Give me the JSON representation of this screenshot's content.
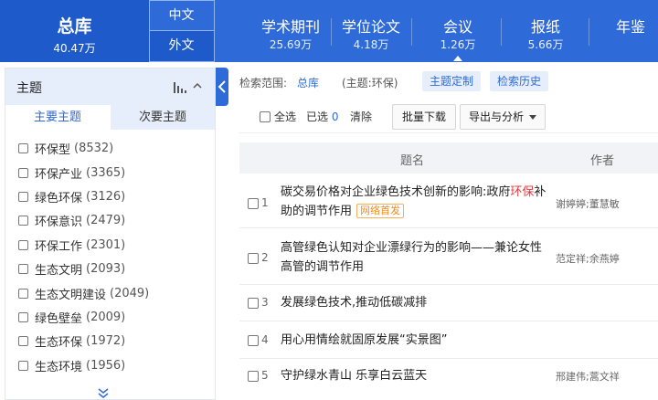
{
  "header": {
    "total": {
      "label": "总库",
      "count": "40.47万"
    },
    "lang_tabs": [
      "中文",
      "外文"
    ],
    "db_tabs": [
      {
        "label": "学术期刊",
        "count": "25.69万"
      },
      {
        "label": "学位论文",
        "count": "4.18万"
      },
      {
        "label": "会议",
        "count": "1.26万"
      },
      {
        "label": "报纸",
        "count": "5.66万"
      },
      {
        "label": "年鉴",
        "count": ""
      }
    ]
  },
  "sidebar": {
    "title": "主题",
    "tabs": [
      "主要主题",
      "次要主题"
    ],
    "facets": [
      {
        "label": "环保型",
        "count": "(8532)"
      },
      {
        "label": "环保产业",
        "count": "(3365)"
      },
      {
        "label": "绿色环保",
        "count": "(3126)"
      },
      {
        "label": "环保意识",
        "count": "(2479)"
      },
      {
        "label": "环保工作",
        "count": "(2301)"
      },
      {
        "label": "生态文明",
        "count": "(2093)"
      },
      {
        "label": "生态文明建设",
        "count": "(2049)"
      },
      {
        "label": "绿色壁垒",
        "count": "(2009)"
      },
      {
        "label": "生态环保",
        "count": "(1972)"
      },
      {
        "label": "生态环境",
        "count": "(1956)"
      }
    ]
  },
  "search": {
    "scope_label": "检索范围:",
    "scope_value": "总库",
    "query": "(主题:环保)",
    "topic_button": "主题定制",
    "history_button": "检索历史"
  },
  "toolbar": {
    "select_all": "全选",
    "selected_label": "已选",
    "selected_count": "0",
    "clear": "清除",
    "batch_download": "批量下载",
    "export": "导出与分析"
  },
  "table": {
    "headers": {
      "title": "题名",
      "author": "作者"
    },
    "rows": [
      {
        "index": "1",
        "title_before": "碳交易价格对企业绿色技术创新的影响:政府",
        "title_highlight": "环保",
        "title_after": "补助的调节作用",
        "badge": "网络首发",
        "author": "谢婷婷;董慧敏"
      },
      {
        "index": "2",
        "title_before": "高管绿色认知对企业漂绿行为的影响——兼论女性高管的调节作用",
        "title_highlight": "",
        "title_after": "",
        "badge": "",
        "author": "范定祥;余燕婷"
      },
      {
        "index": "3",
        "title_before": "发展绿色技术,推动低碳减排",
        "title_highlight": "",
        "title_after": "",
        "badge": "",
        "author": ""
      },
      {
        "index": "4",
        "title_before": "用心用情绘就固原发展“实景图”",
        "title_highlight": "",
        "title_after": "",
        "badge": "",
        "author": ""
      },
      {
        "index": "5",
        "title_before": "守护绿水青山 乐享白云蓝天",
        "title_highlight": "",
        "title_after": "",
        "badge": "",
        "author": "邢建伟;蒿文祥"
      }
    ]
  },
  "colors": {
    "brand": "#2f6bd8",
    "brand_dark": "#1e5ac9",
    "highlight": "#e4393c",
    "badge": "#f08c1a"
  }
}
